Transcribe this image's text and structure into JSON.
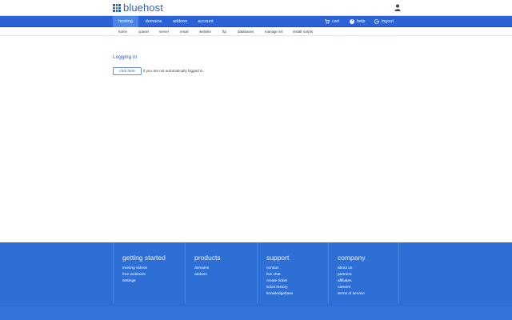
{
  "brand": {
    "name": "bluehost",
    "color": "#2b62c4"
  },
  "header": {
    "user_icon": "user-icon"
  },
  "nav": {
    "tabs": [
      {
        "label": "hosting",
        "active": true
      },
      {
        "label": "domains",
        "active": false
      },
      {
        "label": "addons",
        "active": false
      },
      {
        "label": "account",
        "active": false
      }
    ],
    "right": [
      {
        "label": "cart",
        "icon": "cart-icon"
      },
      {
        "label": "help",
        "icon": "help-icon"
      },
      {
        "label": "logout",
        "icon": "logout-icon"
      }
    ]
  },
  "subnav": {
    "items": [
      "home",
      "cpanel",
      "server",
      "email",
      "website",
      "ftp",
      "databases",
      "manage ssl",
      "install scripts"
    ]
  },
  "main": {
    "title": "Logging in",
    "button_label": "click here",
    "note": "if you are not automatically logged in."
  },
  "footer": {
    "columns": [
      {
        "heading": "getting started",
        "links": [
          "training videos",
          "free webinars",
          "settings"
        ]
      },
      {
        "heading": "products",
        "links": [
          "domains",
          "addons"
        ]
      },
      {
        "heading": "support",
        "links": [
          "contact",
          "live chat",
          "create ticket",
          "ticket history",
          "knowledgebase"
        ]
      },
      {
        "heading": "company",
        "links": [
          "about us",
          "partners",
          "affiliates",
          "careers",
          "terms of service"
        ]
      }
    ]
  }
}
